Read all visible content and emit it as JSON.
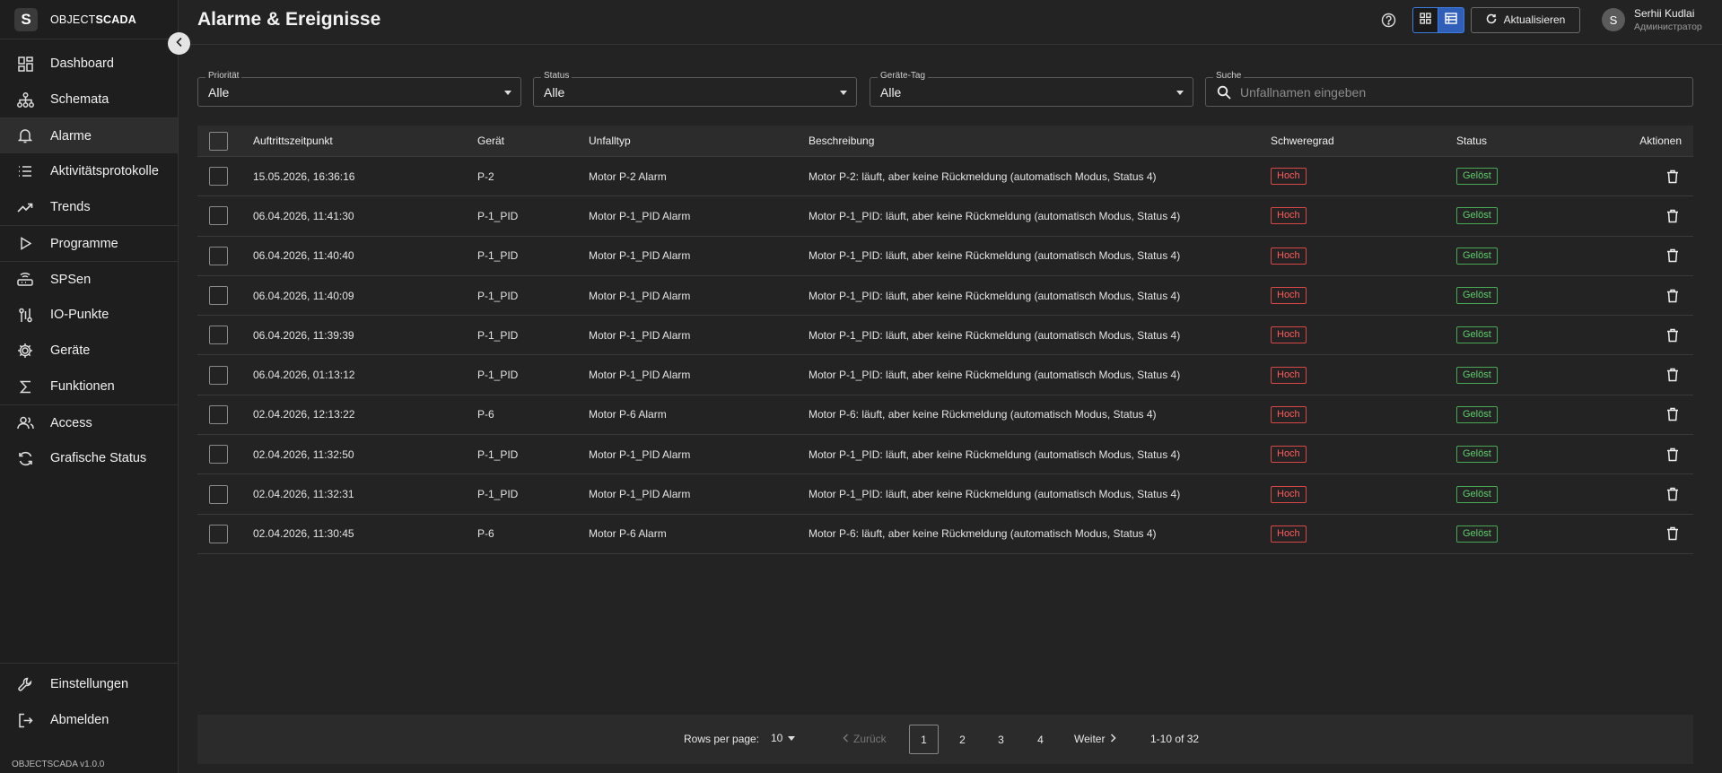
{
  "brand": {
    "logo_letter": "S",
    "name_light": "OBJECT",
    "name_bold": "SCADA",
    "version": "OBJECTSCADA v1.0.0"
  },
  "sidebar": {
    "items": [
      {
        "label": "Dashboard",
        "icon": "dashboard-icon"
      },
      {
        "label": "Schemata",
        "icon": "sitemap-icon"
      },
      {
        "label": "Alarme",
        "icon": "bell-icon"
      },
      {
        "label": "Aktivitätsprotokolle",
        "icon": "list-icon"
      },
      {
        "label": "Trends",
        "icon": "trending-icon"
      },
      {
        "label": "Programme",
        "icon": "play-icon"
      },
      {
        "label": "SPSen",
        "icon": "router-icon"
      },
      {
        "label": "IO-Punkte",
        "icon": "io-icon"
      },
      {
        "label": "Geräte",
        "icon": "gear-icon"
      },
      {
        "label": "Funktionen",
        "icon": "sigma-icon"
      },
      {
        "label": "Access",
        "icon": "users-icon"
      },
      {
        "label": "Grafische Status",
        "icon": "cycle-icon"
      }
    ],
    "bottom_items": [
      {
        "label": "Einstellungen",
        "icon": "wrench-icon"
      },
      {
        "label": "Abmelden",
        "icon": "logout-icon"
      }
    ]
  },
  "header": {
    "title": "Alarme & Ereignisse",
    "refresh_label": "Aktualisieren",
    "user_initial": "S",
    "user_name": "Serhii Kudlai",
    "user_role": "Администратор"
  },
  "filters": {
    "priority": {
      "label": "Priorität",
      "value": "Alle"
    },
    "status": {
      "label": "Status",
      "value": "Alle"
    },
    "device_tag": {
      "label": "Geräte-Tag",
      "value": "Alle"
    },
    "search": {
      "label": "Suche",
      "placeholder": "Unfallnamen eingeben"
    }
  },
  "table": {
    "headers": {
      "time": "Auftrittszeitpunkt",
      "device": "Gerät",
      "type": "Unfalltyp",
      "description": "Beschreibung",
      "severity": "Schweregrad",
      "status": "Status",
      "actions": "Aktionen"
    },
    "rows": [
      {
        "time": "15.05.2026, 16:36:16",
        "device": "P-2",
        "type": "Motor P-2 Alarm",
        "description": "Motor P-2: läuft, aber keine Rückmeldung (automatisch Modus, Status 4)",
        "severity": "Hoch",
        "status": "Gelöst"
      },
      {
        "time": "06.04.2026, 11:41:30",
        "device": "P-1_PID",
        "type": "Motor P-1_PID Alarm",
        "description": "Motor P-1_PID: läuft, aber keine Rückmeldung (automatisch Modus, Status 4)",
        "severity": "Hoch",
        "status": "Gelöst"
      },
      {
        "time": "06.04.2026, 11:40:40",
        "device": "P-1_PID",
        "type": "Motor P-1_PID Alarm",
        "description": "Motor P-1_PID: läuft, aber keine Rückmeldung (automatisch Modus, Status 4)",
        "severity": "Hoch",
        "status": "Gelöst"
      },
      {
        "time": "06.04.2026, 11:40:09",
        "device": "P-1_PID",
        "type": "Motor P-1_PID Alarm",
        "description": "Motor P-1_PID: läuft, aber keine Rückmeldung (automatisch Modus, Status 4)",
        "severity": "Hoch",
        "status": "Gelöst"
      },
      {
        "time": "06.04.2026, 11:39:39",
        "device": "P-1_PID",
        "type": "Motor P-1_PID Alarm",
        "description": "Motor P-1_PID: läuft, aber keine Rückmeldung (automatisch Modus, Status 4)",
        "severity": "Hoch",
        "status": "Gelöst"
      },
      {
        "time": "06.04.2026, 01:13:12",
        "device": "P-1_PID",
        "type": "Motor P-1_PID Alarm",
        "description": "Motor P-1_PID: läuft, aber keine Rückmeldung (automatisch Modus, Status 4)",
        "severity": "Hoch",
        "status": "Gelöst"
      },
      {
        "time": "02.04.2026, 12:13:22",
        "device": "P-6",
        "type": "Motor P-6 Alarm",
        "description": "Motor P-6: läuft, aber keine Rückmeldung (automatisch Modus, Status 4)",
        "severity": "Hoch",
        "status": "Gelöst"
      },
      {
        "time": "02.04.2026, 11:32:50",
        "device": "P-1_PID",
        "type": "Motor P-1_PID Alarm",
        "description": "Motor P-1_PID: läuft, aber keine Rückmeldung (automatisch Modus, Status 4)",
        "severity": "Hoch",
        "status": "Gelöst"
      },
      {
        "time": "02.04.2026, 11:32:31",
        "device": "P-1_PID",
        "type": "Motor P-1_PID Alarm",
        "description": "Motor P-1_PID: läuft, aber keine Rückmeldung (automatisch Modus, Status 4)",
        "severity": "Hoch",
        "status": "Gelöst"
      },
      {
        "time": "02.04.2026, 11:30:45",
        "device": "P-6",
        "type": "Motor P-6 Alarm",
        "description": "Motor P-6: läuft, aber keine Rückmeldung (automatisch Modus, Status 4)",
        "severity": "Hoch",
        "status": "Gelöst"
      }
    ]
  },
  "pagination": {
    "rows_label": "Rows per page:",
    "rows_value": "10",
    "prev_label": "Zurück",
    "pages": [
      "1",
      "2",
      "3",
      "4"
    ],
    "current_page": "1",
    "next_label": "Weiter",
    "range": "1-10 of 32"
  },
  "colors": {
    "accent": "#3e7de0",
    "severity_high": "#ff5a5a",
    "status_resolved": "#5fcf6d"
  }
}
